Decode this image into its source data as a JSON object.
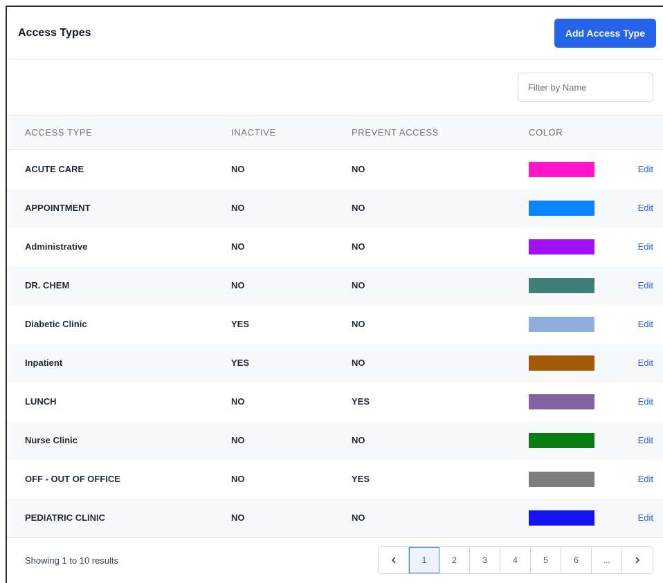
{
  "header": {
    "title": "Access Types",
    "add_button_label": "Add Access Type"
  },
  "filter": {
    "placeholder": "Filter by Name",
    "value": ""
  },
  "table": {
    "columns": [
      "ACCESS TYPE",
      "INACTIVE",
      "PREVENT ACCESS",
      "COLOR"
    ],
    "edit_label": "Edit",
    "rows": [
      {
        "name": "ACUTE CARE",
        "inactive": "NO",
        "prevent": "NO",
        "color": "#ff14c8"
      },
      {
        "name": "APPOINTMENT",
        "inactive": "NO",
        "prevent": "NO",
        "color": "#0a84ff"
      },
      {
        "name": "Administrative",
        "inactive": "NO",
        "prevent": "NO",
        "color": "#a010f5"
      },
      {
        "name": "DR. CHEM",
        "inactive": "NO",
        "prevent": "NO",
        "color": "#3f7f7a"
      },
      {
        "name": "Diabetic Clinic",
        "inactive": "YES",
        "prevent": "NO",
        "color": "#8fb0de"
      },
      {
        "name": "Inpatient",
        "inactive": "YES",
        "prevent": "NO",
        "color": "#a35a05"
      },
      {
        "name": "LUNCH",
        "inactive": "NO",
        "prevent": "YES",
        "color": "#8063a0"
      },
      {
        "name": "Nurse Clinic",
        "inactive": "NO",
        "prevent": "NO",
        "color": "#0a7d12"
      },
      {
        "name": "OFF - OUT OF OFFICE",
        "inactive": "NO",
        "prevent": "YES",
        "color": "#7d7d7d"
      },
      {
        "name": "PEDIATRIC CLINIC",
        "inactive": "NO",
        "prevent": "NO",
        "color": "#1414f0"
      }
    ]
  },
  "footer": {
    "showing": "Showing 1 to 10 results",
    "pages": [
      "1",
      "2",
      "3",
      "4",
      "5",
      "6",
      "..."
    ],
    "current_page": "1",
    "prev_icon": "chevron-left-icon",
    "next_icon": "chevron-right-icon"
  },
  "colors": {
    "accent": "#2563eb",
    "stripe": "#f8f9fb",
    "border": "#e5e7eb"
  }
}
